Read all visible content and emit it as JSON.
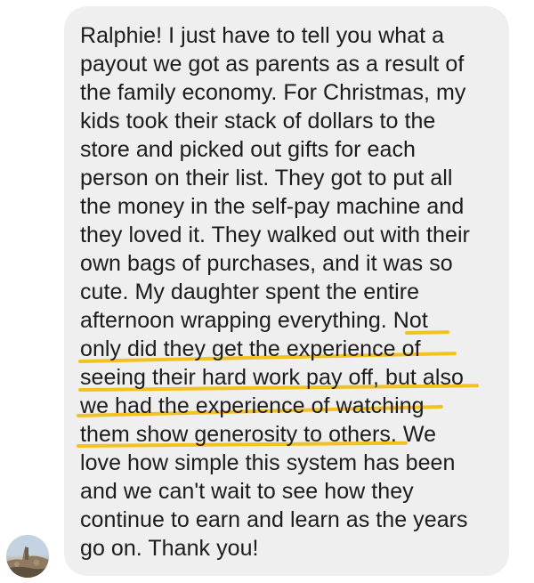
{
  "message": {
    "lines": [
      "Ralphie! I just have to tell you what a",
      "payout we got as parents as a result of",
      "the family economy. For Christmas, my",
      "kids took their stack of dollars to the",
      "store and picked out gifts for each",
      "person on their list. They got to put all",
      "the money in the self-pay machine and",
      "they loved it. They walked out with their",
      "own bags of purchases, and it was so",
      "cute. My daughter spent the entire",
      "afternoon wrapping everything. Not",
      "only did they get the experience of",
      "seeing their hard work pay off, but also",
      "we had the experience of watching",
      "them show generosity to others. We",
      "love how simple this system has been",
      "and we can't wait to see how they",
      "continue to earn and learn as the years",
      "go on. Thank you!"
    ]
  },
  "colors": {
    "bubble": "#efefef",
    "text": "#1c1c1e",
    "highlight": "#f3c21f"
  },
  "avatar": {
    "icon": "profile-photo-icon"
  }
}
